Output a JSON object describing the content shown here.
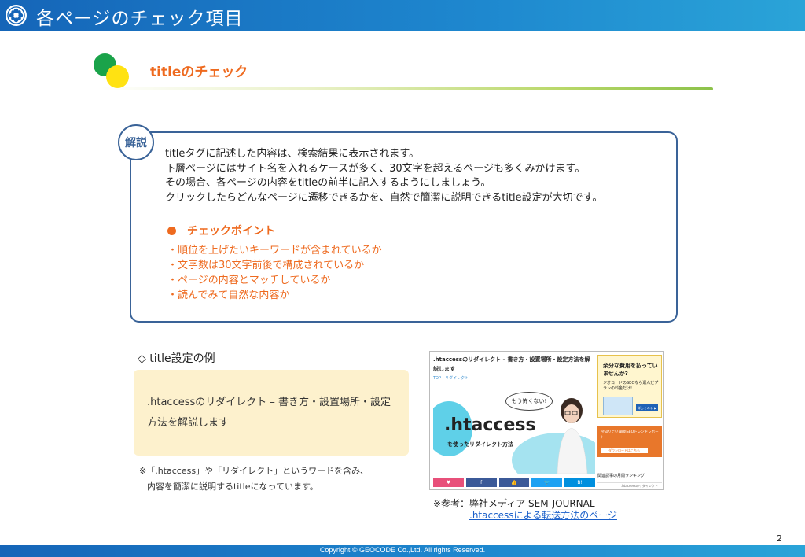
{
  "header": {
    "title": "各ページのチェック項目"
  },
  "section": {
    "title": "titleのチェック"
  },
  "explanation": {
    "badge": "解説",
    "lines": [
      "titleタグに記述した内容は、検索結果に表示されます。",
      "下層ページにはサイト名を入れるケースが多く、30文字を超えるページも多くみかけます。",
      "その場合、各ページの内容をtitleの前半に記入するようにしましょう。",
      "クリックしたらどんなページに遷移できるかを、自然で簡潔に説明できるtitle設定が大切です。"
    ],
    "check_title": "チェックポイント",
    "check_items": [
      "・順位を上げたいキーワードが含まれているか",
      "・文字数は30文字前後で構成されているか",
      "・ページの内容とマッチしているか",
      "・読んでみて自然な内容か"
    ]
  },
  "example": {
    "heading": "◇ title設定の例",
    "text": ".htaccessのリダイレクト – 書き方・設置場所・設定方法を解説します",
    "note_line1": "※「.htaccess」や「リダイレクト」というワードを含み、",
    "note_line2": "内容を簡潔に説明するtitleになっています。"
  },
  "thumbnail": {
    "title": ".htaccessのリダイレクト – 書き方・設置場所・設定方法を解説します",
    "breadcrumb": "TOP  ›  リダイレクト",
    "bubble": "もう怖くない!",
    "hero_title": ".htaccess",
    "hero_sub": "を使ったリダイレクト方法",
    "share_buttons": [
      "♥",
      "f",
      "👍",
      "🐦",
      "B!"
    ],
    "share_colors": [
      "#e8507a",
      "#3b5998",
      "#3b5998",
      "#1da1f2",
      "#008fde"
    ],
    "side1_title": "余分な費用を払っていませんか?",
    "side1_sub": "ジオコードのSEOなら選んだプランの料金だけ!",
    "side1_button": "詳しくみる ▶",
    "side2_text": "今知りたい 最新SEOトレンドレポート",
    "side2_button": "ダウンロードはこちら",
    "ranking": "関連記事の月間ランキング",
    "ranking_item": ".htaccessのリダイレクト 書き方"
  },
  "reference": {
    "label": "※参考：弊社メディア SEM-JOURNAL",
    "link": ".htaccessによる転送方法のページ"
  },
  "page_number": "2",
  "footer": {
    "copyright": "Copyright © GEOCODE Co.,Ltd. All rights Reserved."
  }
}
